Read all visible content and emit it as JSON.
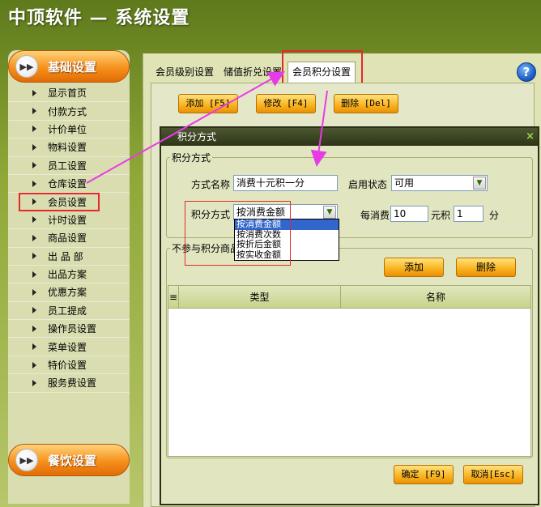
{
  "app": {
    "title": "中顶软件 — 系统设置"
  },
  "sidebar": {
    "top_header": "基础设置",
    "bottom_header": "餐饮设置",
    "items": [
      {
        "label": "显示首页"
      },
      {
        "label": "付款方式"
      },
      {
        "label": "计价单位"
      },
      {
        "label": "物料设置"
      },
      {
        "label": "员工设置"
      },
      {
        "label": "仓库设置"
      },
      {
        "label": "会员设置"
      },
      {
        "label": "计时设置"
      },
      {
        "label": "商品设置"
      },
      {
        "label": "出 品 部"
      },
      {
        "label": "出品方案"
      },
      {
        "label": "优惠方案"
      },
      {
        "label": "员工提成"
      },
      {
        "label": "操作员设置"
      },
      {
        "label": "菜单设置"
      },
      {
        "label": "特价设置"
      },
      {
        "label": "服务费设置"
      }
    ],
    "highlighted_item": "会员设置"
  },
  "tabs": [
    {
      "label": "会员级别设置"
    },
    {
      "label": "储值折兑设置"
    },
    {
      "label": "会员积分设置"
    }
  ],
  "toolbar": {
    "add_label": "添加 [F5]",
    "edit_label": "修改 [F4]",
    "delete_label": "删除 [Del]"
  },
  "dialog": {
    "title": "积分方式",
    "close_glyph": "×",
    "group_title": "积分方式",
    "method_name_label": "方式名称",
    "method_name_value": "消费十元积一分",
    "enable_status_label": "启用状态",
    "enable_status_value": "可用",
    "points_method_label": "积分方式",
    "points_method_value": "按消费金额",
    "per_spend_label": "每消费",
    "per_spend_value": "10",
    "yuan_points_label": "元积",
    "points_value": "1",
    "fen_label": "分",
    "dropdown_options": [
      "按消费金额",
      "按消费次数",
      "按折后金额",
      "按实收金额"
    ],
    "excluded_group_title": "不参与积分商品",
    "add_button": "添加",
    "delete_button": "删除",
    "grid_columns": [
      "类型",
      "名称"
    ],
    "ok_button": "确定 [F9]",
    "cancel_button": "取消[Esc]"
  },
  "icons": {
    "help": "help-icon",
    "sidebar_header": "forward-circle-icon"
  },
  "colors": {
    "annotation_red": "#e5282a",
    "annotation_magenta": "#e83be8",
    "orange_button": "#f9b21e"
  }
}
